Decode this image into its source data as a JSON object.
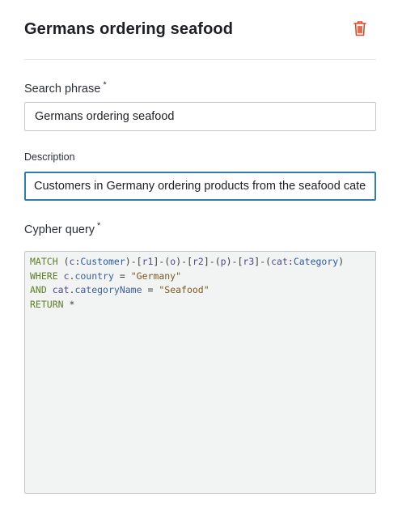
{
  "header": {
    "title": "Germans ordering seafood",
    "delete_icon": "trash-icon",
    "delete_color": "#d9482b"
  },
  "search_phrase": {
    "label": "Search phrase",
    "required_mark": "*",
    "value": "Germans ordering seafood"
  },
  "description": {
    "label": "Description",
    "value": "Customers in Germany ordering products from the seafood category"
  },
  "cypher_query": {
    "label": "Cypher query",
    "required_mark": "*",
    "lines": [
      "MATCH (c:Customer)-[r1]-(o)-[r2]-(p)-[r3]-(cat:Category)",
      "WHERE c.country = \"Germany\"",
      "AND cat.categoryName = \"Seafood\"",
      "RETURN *"
    ]
  },
  "colors": {
    "accent": "#2e7fa2",
    "keyword": "#5f7f2a",
    "string": "#7a5a1e",
    "code_background": "#f2f3f3"
  }
}
